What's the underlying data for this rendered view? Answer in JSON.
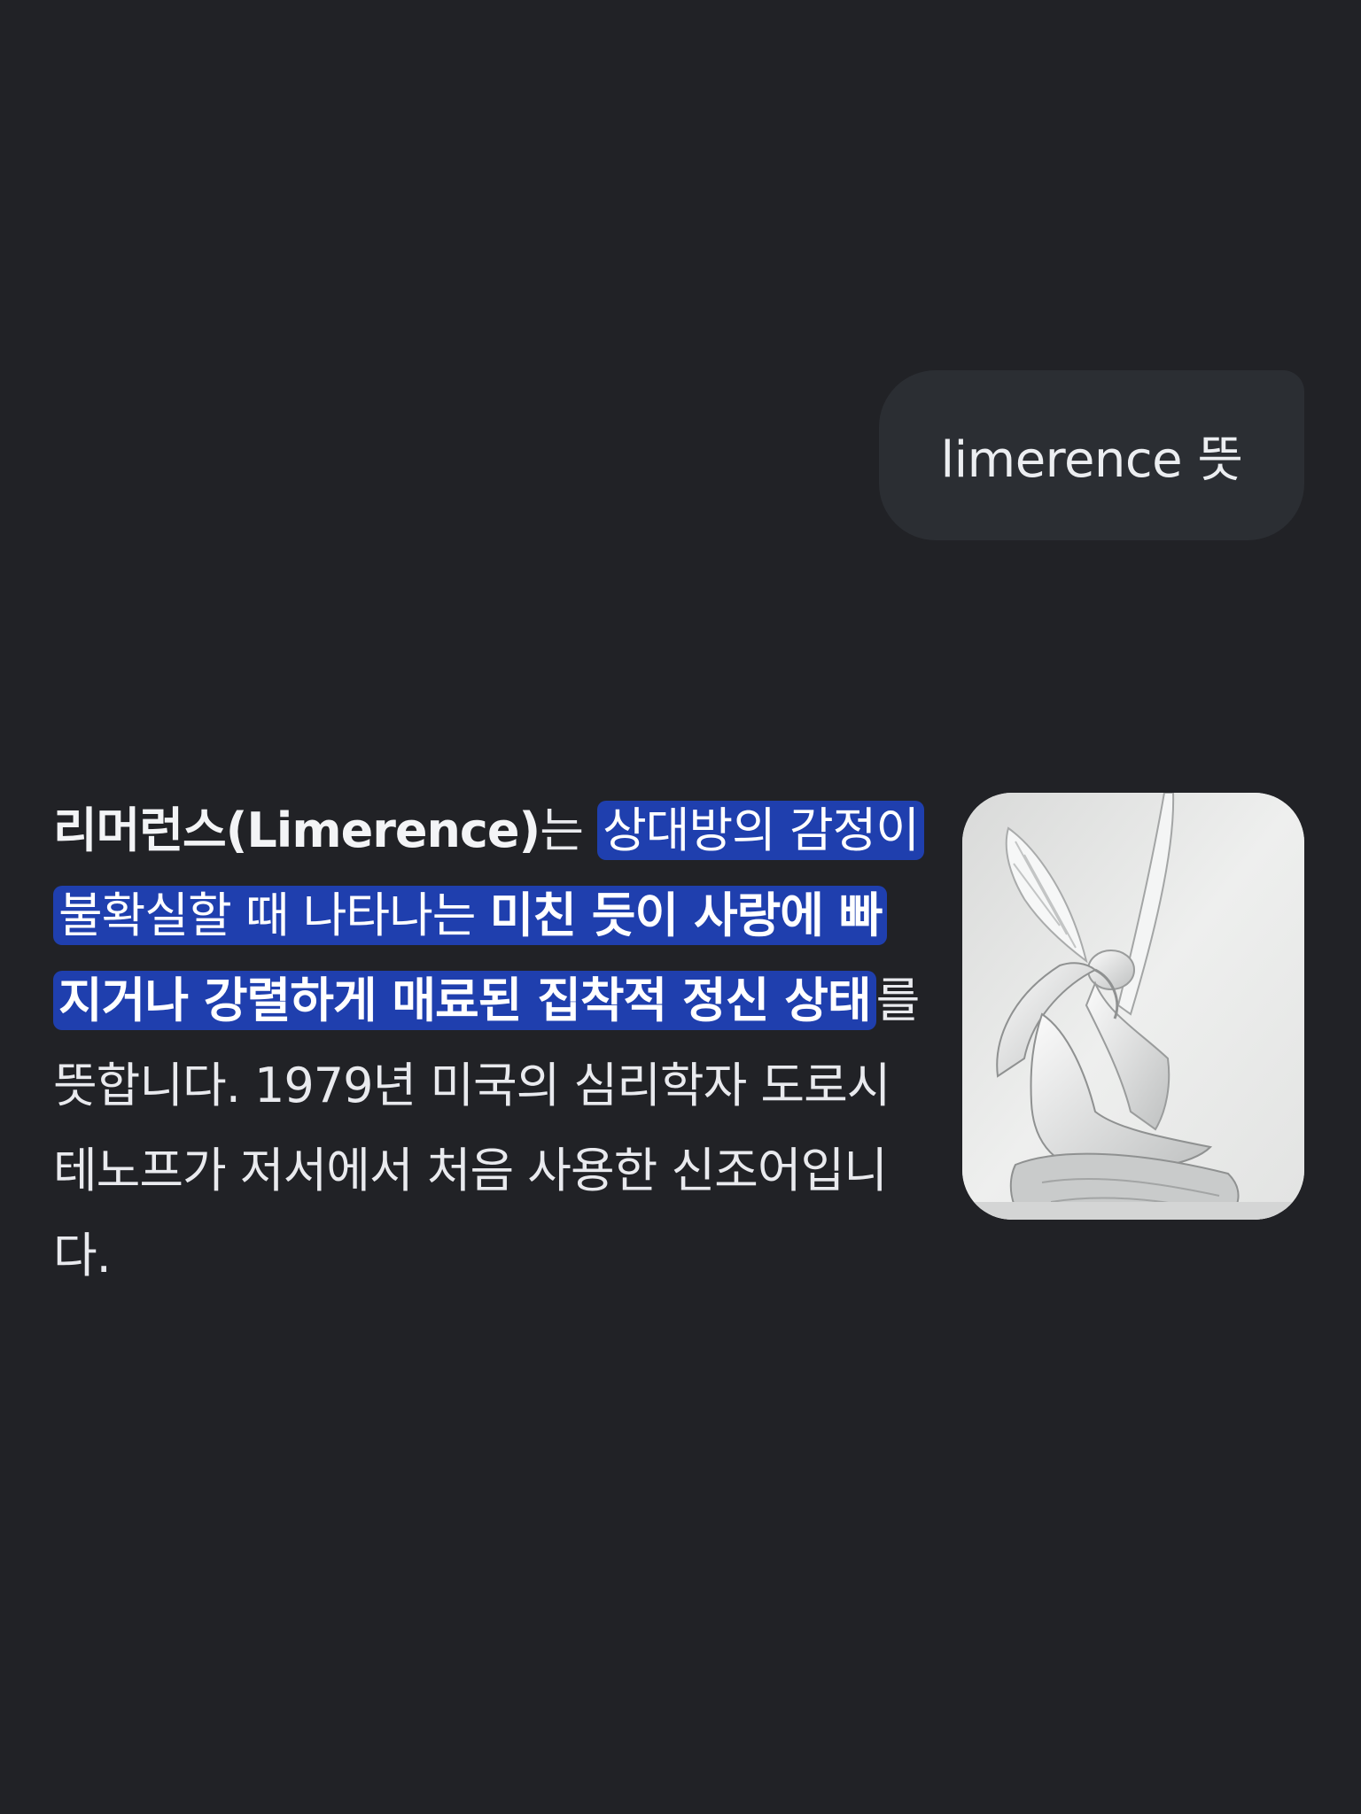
{
  "query": {
    "text": "limerence 뜻"
  },
  "answer": {
    "term": "리머런스(Limerence)",
    "term_suffix": "는 ",
    "highlight_part1": "상대방의 감정이 불확실할 때 나타나는 ",
    "highlight_part2_bold": "미친 듯이 사랑에 빠지거나 강렬하게 매료된 집착적 정신 상태",
    "rest": "를 뜻합니다. 1979년 미국의 심리학자 도로시 테노프가 저서에서 처음 사용한 신조어입니다."
  },
  "thumbnail": {
    "icon": "statue-image",
    "subject": "Psyche Revived by Cupid's Kiss (marble sculpture)"
  },
  "colors": {
    "background": "#212226",
    "bubble": "#2b2e33",
    "highlight": "#1f3fae",
    "text": "#e9eaee"
  }
}
